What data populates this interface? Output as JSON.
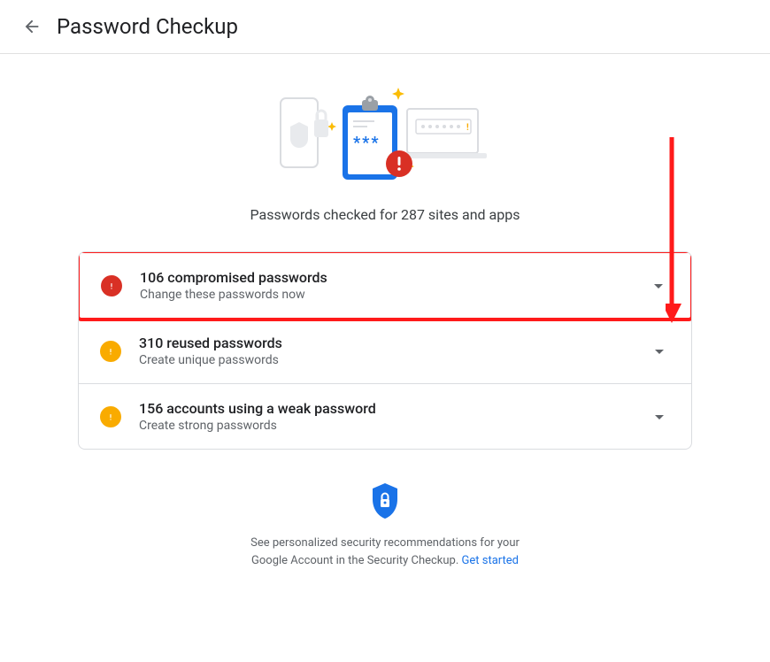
{
  "header": {
    "title": "Password Checkup"
  },
  "subtitle": "Passwords checked for 287 sites and apps",
  "cards": [
    {
      "title": "106 compromised passwords",
      "subtitle": "Change these passwords now",
      "status": "red"
    },
    {
      "title": "310 reused passwords",
      "subtitle": "Create unique passwords",
      "status": "yellow"
    },
    {
      "title": "156 accounts using a weak password",
      "subtitle": "Create strong passwords",
      "status": "yellow"
    }
  ],
  "footer": {
    "text": "See personalized security recommendations for your Google Account in the Security Checkup. ",
    "link_text": "Get started"
  }
}
